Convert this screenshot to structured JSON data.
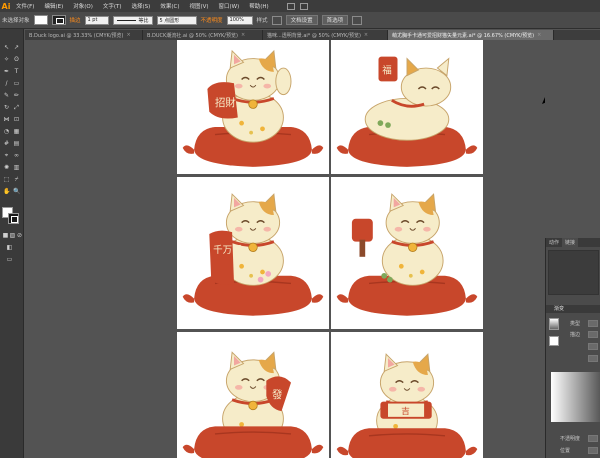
{
  "app": {
    "logo": "Ai"
  },
  "menu": {
    "items": [
      "文件(F)",
      "编辑(E)",
      "对象(O)",
      "文字(T)",
      "选择(S)",
      "效果(C)",
      "视图(V)",
      "窗口(W)",
      "帮助(H)"
    ]
  },
  "control": {
    "selection_label": "未选择对象",
    "stroke_label": "描边",
    "stroke_value": "1 pt",
    "stroke_style": "等比",
    "brush_value": "5 点圆形",
    "opacity_label": "不透明度",
    "opacity_value": "100%",
    "style_label": "样式",
    "doc_setup_label": "文档设置",
    "prefs_label": "首选项"
  },
  "tabs": [
    {
      "label": "B.Duck logo.ai @ 33.33% (CMYK/预览)",
      "active": false
    },
    {
      "label": "B.DUCK潮流社.ai @ 50% (CMYK/预览)",
      "active": false
    },
    {
      "label": "猫咪...透明背景.ai* @ 50% (CMYK/预览)",
      "active": false
    },
    {
      "label": "萌尤胸手卡通可爱招财猫矢量元素.ai* @ 16.67% (CMYK/预览)",
      "active": true
    }
  ],
  "panel": {
    "tabs": [
      "动作",
      "链接"
    ],
    "gradient_title": "渐变",
    "type_label": "类型",
    "stroke_label": "描边",
    "opacity_label": "不透明度",
    "position_label": "位置"
  },
  "artwork": {
    "text_fan": "招財",
    "text_sign_top": "福",
    "text_banner": "千万币",
    "text_scroll": "吉",
    "text_fan2": "發"
  },
  "colors": {
    "accent_orange": "#ff8c1a",
    "cushion_red": "#c8472b",
    "cat_cream": "#f6ecc9",
    "patch_orange": "#e5a84a"
  }
}
